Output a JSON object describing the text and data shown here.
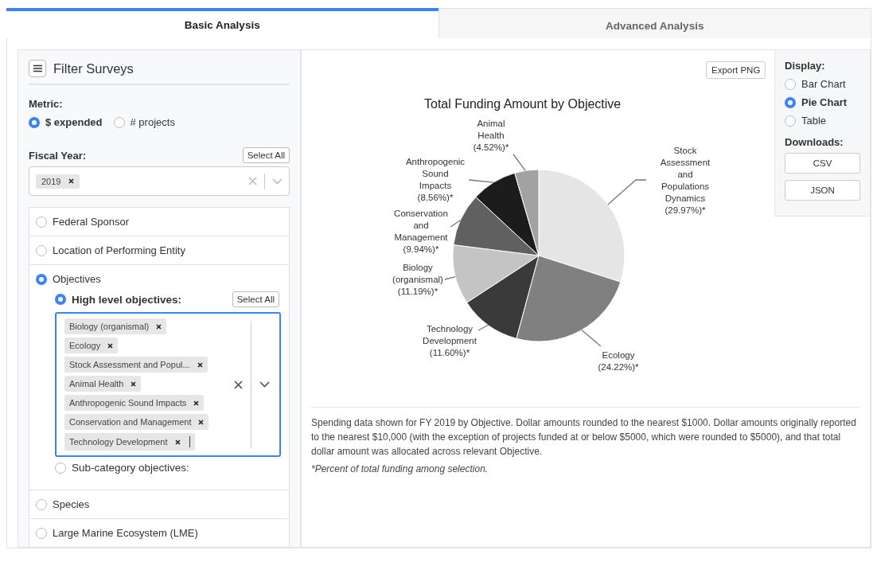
{
  "tabs": [
    {
      "label": "Basic Analysis",
      "selected": true
    },
    {
      "label": "Advanced Analysis",
      "selected": false
    }
  ],
  "filter_panel": {
    "title": "Filter Surveys",
    "metric": {
      "label": "Metric:",
      "options": [
        {
          "label": "$ expended",
          "selected": true
        },
        {
          "label": "# projects",
          "selected": false
        }
      ]
    },
    "fiscal_year": {
      "label": "Fiscal Year:",
      "select_all": "Select All",
      "tags": [
        "2019"
      ]
    },
    "filter_groups": [
      {
        "label": "Federal Sponsor",
        "selected": false,
        "expanded": false
      },
      {
        "label": "Location of Performing Entity",
        "selected": false,
        "expanded": false
      },
      {
        "label": "Objectives",
        "selected": true,
        "expanded": true,
        "options": [
          {
            "label": "High level objectives:",
            "selected": true,
            "select_all": "Select All",
            "focused": true,
            "tags": [
              "Biology (organismal)",
              "Ecology",
              "Stock Assessment and Popul...",
              "Animal Health",
              "Anthropogenic Sound Impacts",
              "Conservation and Management",
              "Technology Development"
            ]
          },
          {
            "label": "Sub-category objectives:",
            "selected": false
          }
        ]
      },
      {
        "label": "Species",
        "selected": false,
        "expanded": false
      },
      {
        "label": "Large Marine Ecosystem (LME)",
        "selected": false,
        "expanded": false
      }
    ]
  },
  "chart_panel": {
    "export_button": "Export PNG",
    "chart_data": {
      "type": "pie",
      "title": "Total Funding Amount by Objective",
      "categories": [
        "Stock Assessment and Populations Dynamics",
        "Ecology",
        "Technology Development",
        "Biology (organismal)",
        "Conservation and Management",
        "Anthropogenic Sound Impacts",
        "Animal Health"
      ],
      "values": [
        29.97,
        24.22,
        11.6,
        11.19,
        9.94,
        8.56,
        4.52
      ],
      "colors": [
        "#e5e5e5",
        "#808080",
        "#3a3a3a",
        "#c4c4c4",
        "#606060",
        "#1c1c1c",
        "#a2a2a2"
      ],
      "value_labels": [
        "(29.97%)*",
        "(24.22%)*",
        "(11.60%)*",
        "(11.19%)*",
        "(9.94%)*",
        "(8.56%)*",
        "(4.52%)*"
      ]
    },
    "note": "Spending data shown for FY 2019 by Objective. Dollar amounts rounded to the nearest $1000. Dollar amounts originally reported to the nearest $10,000 (with the exception of projects funded at or below $5000, which were rounded to $5000), and that total dollar amount was allocated across relevant Objective.",
    "footnote": "*Percent of total funding among selection."
  },
  "display_panel": {
    "label": "Display:",
    "options": [
      {
        "label": "Bar Chart",
        "selected": false
      },
      {
        "label": "Pie Chart",
        "selected": true
      },
      {
        "label": "Table",
        "selected": false
      }
    ],
    "downloads_label": "Downloads:",
    "downloads": [
      "CSV",
      "JSON"
    ]
  }
}
